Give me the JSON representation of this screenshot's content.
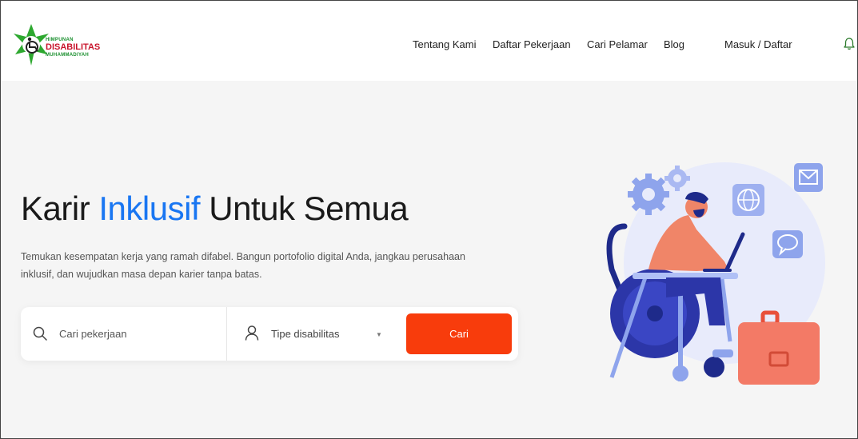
{
  "brand": {
    "line1": "HIMPUNAN",
    "line2": "DISABILITAS",
    "line3": "MUHAMMADIYAH"
  },
  "nav": {
    "items": [
      "Tentang Kami",
      "Daftar Pekerjaan",
      "Cari Pelamar",
      "Blog"
    ],
    "login": "Masuk / Daftar"
  },
  "hero": {
    "title_part1": "Karir ",
    "title_accent": "Inklusif",
    "title_part2": " Untuk Semua",
    "description": "Temukan kesempatan kerja yang ramah difabel. Bangun portofolio digital Anda, jangkau perusahaan inklusif, dan wujudkan masa depan karier tanpa batas."
  },
  "search": {
    "job_placeholder": "Cari pekerjaan",
    "disability_label": "Tipe disabilitas",
    "button_label": "Cari"
  },
  "icons": {
    "search": "search-icon",
    "user": "user-icon",
    "bell": "bell-icon",
    "caret": "caret-down-icon"
  },
  "colors": {
    "accent_blue": "#1976f2",
    "cta_orange": "#f83c0c",
    "brand_red": "#c8142b",
    "brand_green": "#1a8f2e"
  }
}
